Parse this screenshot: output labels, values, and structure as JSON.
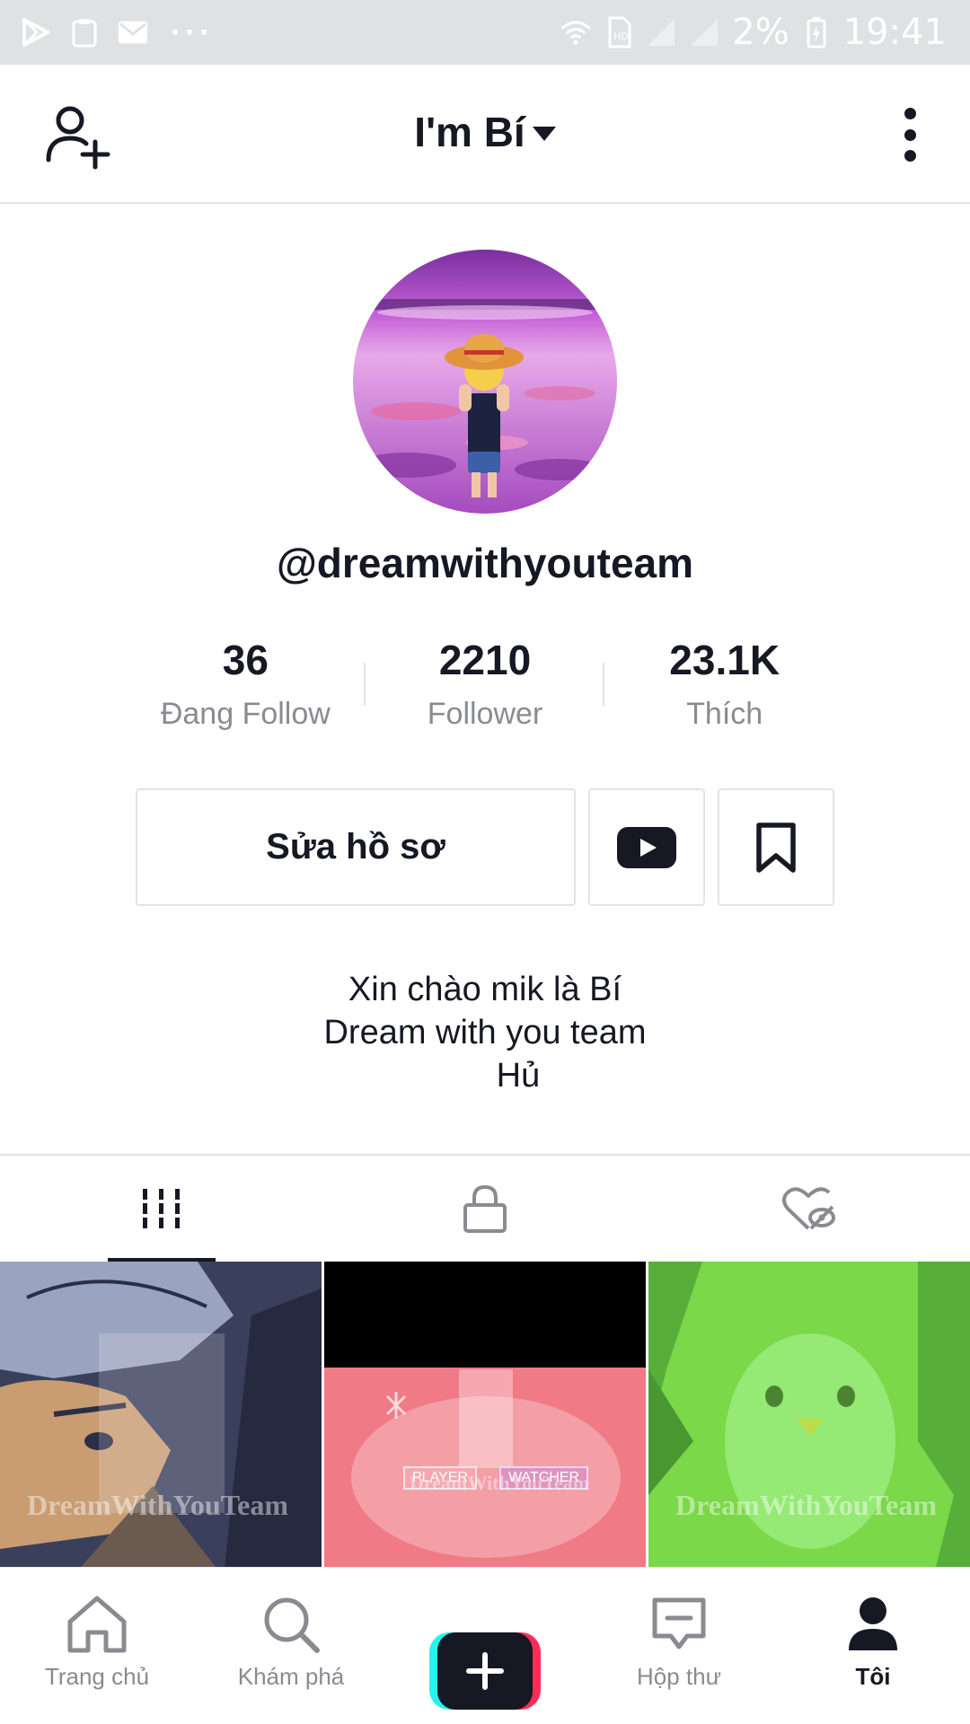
{
  "status_bar": {
    "battery_percent": "2%",
    "time": "19:41",
    "more_dots": "···"
  },
  "header": {
    "title": "I'm Bí"
  },
  "profile": {
    "username": "@dreamwithyouteam"
  },
  "stats": [
    {
      "value": "36",
      "label": "Đang Follow"
    },
    {
      "value": "2210",
      "label": "Follower"
    },
    {
      "value": "23.1K",
      "label": "Thích"
    }
  ],
  "actions": {
    "edit_profile": "Sửa hồ sơ"
  },
  "bio": {
    "line1": "Xin chào mik là Bí",
    "line2": "Dream with you team",
    "line3": "       Hủ"
  },
  "tabs": {
    "active": "videos-grid",
    "items": [
      "videos-grid",
      "private-lock",
      "liked-hidden"
    ]
  },
  "videos": [
    {
      "watermark": "DreamWithYouTeam",
      "theme": "dark-blue"
    },
    {
      "watermark": "DreamWithYouTeam",
      "theme": "pink",
      "labels": [
        "PLAYER",
        "WATCHER"
      ]
    },
    {
      "watermark": "DreamWithYouTeam",
      "theme": "green"
    }
  ],
  "bottom_nav": {
    "items": [
      {
        "label": "Trang chủ",
        "icon": "home-icon"
      },
      {
        "label": "Khám phá",
        "icon": "search-icon"
      },
      {
        "label": "",
        "icon": "plus-icon"
      },
      {
        "label": "Hộp thư",
        "icon": "inbox-icon"
      },
      {
        "label": "Tôi",
        "icon": "person-icon"
      }
    ],
    "active": "Tôi"
  },
  "colors": {
    "text_primary": "#161823",
    "text_secondary": "#8a8b91",
    "divider": "#e3e3e4",
    "accent_cyan": "#25f4ee",
    "accent_pink": "#fe2c55"
  }
}
